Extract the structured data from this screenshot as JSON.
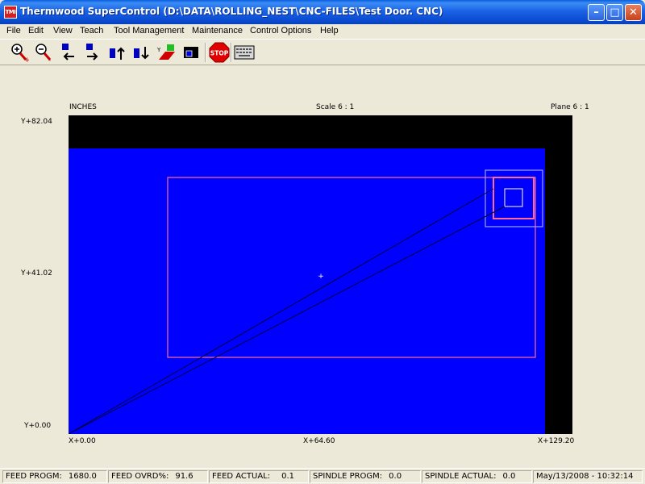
{
  "window": {
    "app_icon_text": "TMI",
    "title": "Thermwood SuperControl (D:\\DATA\\ROLLING_NEST\\CNC-FILES\\Test Door. CNC)",
    "minimize_glyph": "–",
    "maximize_glyph": "□",
    "close_glyph": "✕"
  },
  "menu": [
    "File",
    "Edit",
    "View",
    "Teach",
    "Tool Management",
    "Maintenance",
    "Control Options",
    "Help"
  ],
  "toolbar": {
    "stop_label": "STOP",
    "icons": [
      "zoom-in-icon",
      "zoom-out-icon",
      "move-left-icon",
      "move-right-icon",
      "move-up-icon",
      "move-down-icon",
      "plane-icon",
      "window-view-icon",
      "stop-icon",
      "keyboard-icon"
    ]
  },
  "view": {
    "units": "INCHES",
    "scale": "Scale   6 : 1",
    "plane": "Plane  6 : 1",
    "y_max": "Y+82.04",
    "y_mid": "Y+41.02",
    "y_min": "Y+0.00",
    "x_min": "X+0.00",
    "x_mid": "X+64.60",
    "x_max": "X+129.20"
  },
  "status": {
    "feed_progm_label": "FEED PROGM:",
    "feed_progm_value": "1680.0",
    "feed_ovrd_label": "FEED OVRD%:",
    "feed_ovrd_value": "91.6",
    "feed_actual_label": "FEED ACTUAL:",
    "feed_actual_value": "0.1",
    "spindle_progm_label": "SPINDLE PROGM:",
    "spindle_progm_value": "0.0",
    "spindle_actual_label": "SPINDLE ACTUAL:",
    "spindle_actual_value": "0.0",
    "datetime": "May/13/2008 - 10:32:14"
  },
  "colors": {
    "canvas_bg": "#000000",
    "table": "#0000ff",
    "part_outline": "#ff6a9a",
    "tool_box": "#a0a0ff",
    "toolpath": "#000040"
  }
}
